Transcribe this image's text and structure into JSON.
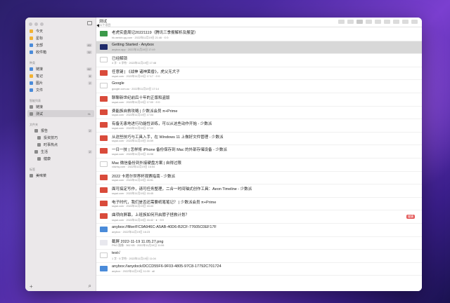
{
  "colors": {
    "window_bg": "#ffffff",
    "sidebar_bg": "#ebe8ea",
    "selected_row": "#d8d8d8",
    "tag_red": "#e45b5b",
    "accent_blue": "#4a8bd9"
  },
  "sidebar": {
    "top_items": [
      {
        "label": "今天",
        "icon": "sun-icon",
        "color": "#f2b233",
        "count": ""
      },
      {
        "label": "星标",
        "icon": "star-icon",
        "color": "#f2b233",
        "count": ""
      },
      {
        "label": "全部",
        "icon": "tray-icon",
        "color": "#4a8bd9",
        "count": "83"
      },
      {
        "label": "收件箱",
        "icon": "inbox-icon",
        "color": "#4a8bd9",
        "count": "32"
      }
    ],
    "type_section": "种类",
    "type_items": [
      {
        "label": "链接",
        "icon": "link-icon",
        "color": "#4a8bd9",
        "count": "62"
      },
      {
        "label": "笔记",
        "icon": "note-icon",
        "color": "#f2b233",
        "count": "8"
      },
      {
        "label": "图片",
        "icon": "image-icon",
        "color": "#4a8bd9",
        "count": "2"
      },
      {
        "label": "文件",
        "icon": "file-icon",
        "color": "#4a8bd9",
        "count": ""
      }
    ],
    "smart_section": "智能列表",
    "smart_items": [
      {
        "label": "链接",
        "icon": "smart-list-icon",
        "color": "#8a8a8a",
        "count": ""
      },
      {
        "label": "测试",
        "icon": "smart-list-icon",
        "color": "#8a8a8a",
        "count": "31"
      }
    ],
    "folder_section": "文件夹",
    "folder_items": [
      {
        "label": "报告",
        "level": 1,
        "count": "2"
      },
      {
        "label": "投资技巧",
        "level": 2,
        "count": ""
      },
      {
        "label": "时事热点",
        "level": 2,
        "count": ""
      },
      {
        "label": "生活",
        "level": 1,
        "count": "2"
      },
      {
        "label": "健康",
        "level": 2,
        "count": ""
      }
    ],
    "tag_section": "标签",
    "tag_items": [
      {
        "label": "美味菜",
        "icon": "tag-icon",
        "color": "#8a8a8a",
        "count": ""
      }
    ],
    "add_label": "+",
    "search_label": "⌕"
  },
  "toolbar": {
    "title": "测试",
    "subtitle": "31个项目"
  },
  "items": [
    {
      "title": "老虎实盘周记20221119（腾讯三季报解析及展望）",
      "meta": "hk.weixin.qq.com · 2022年11月19日 21:46 · ⊙⊙",
      "fav_color": "#3c9a4a",
      "tag": ""
    },
    {
      "title": "Getting Started - Anybox",
      "meta": "anybox.app · 2022年11月19日 17:49",
      "fav_color": "#1f2b6b",
      "tag": ""
    },
    {
      "title": "已经解锁",
      "meta": "4 字 · 4 字符 · 2022年11月19日 17:48",
      "fav_color": "#ffffff",
      "tag": ""
    },
    {
      "title": "任意键 | 《战神 诸神黄昏》，虎父无犬子",
      "meta": "sspai.com · 2022年11月19日 17:17 · ⊙⊙",
      "fav_color": "#d94b3b",
      "tag": ""
    },
    {
      "title": "Google",
      "meta": "google.com.au · 2022年11月19日 17:14",
      "fav_color": "#ffffff",
      "tag": ""
    },
    {
      "title": "聊聊新世纪前后十年的正版和盗版",
      "meta": "sspai.com · 2022年11月19日 17:00 · ⊙⊙",
      "fav_color": "#d94b3b",
      "tag": ""
    },
    {
      "title": "费能族自救攻略 | 少数派会员 π+Prime",
      "meta": "sspai.com · 2022年11月19日 17:04",
      "fav_color": "#d94b3b",
      "tag": ""
    },
    {
      "title": "有备无患地进行功能性训练，可以从这些动作开始 - 少数派",
      "meta": "sspai.com · 2022年11月19日 17:00",
      "fav_color": "#d94b3b",
      "tag": ""
    },
    {
      "title": "从这些技巧与工具入手，在 Windows 11 上做好文件管理 - 少数派",
      "meta": "sspai.com · 2022年11月19日 16:59",
      "fav_color": "#d94b3b",
      "tag": ""
    },
    {
      "title": "一日一技 | 怎样将 iPhone 备份保存到 Mac 的外部存储设备 - 少数派",
      "meta": "sspai.com · 2022年11月19日 16:58",
      "fav_color": "#d94b3b",
      "tag": ""
    },
    {
      "title": "Mac 微信备份到外接硬盘方案 | 自得过限",
      "meta": "xldzhq.com · 2022年11月19日 16:54",
      "fav_color": "#ffffff",
      "tag": ""
    },
    {
      "title": "2022 卡塔尔世界杯观赛指南 - 少数派",
      "meta": "sspai.com · 2022年11月19日 16:51",
      "fav_color": "#d94b3b",
      "tag": ""
    },
    {
      "title": "面可搞定写作，请可任务整理，二合一时间轴式创作工具：Aeon Timeline - 少数派",
      "meta": "sspai.com · 2022年11月19日 16:45",
      "fav_color": "#d94b3b",
      "tag": ""
    },
    {
      "title": "电子时代，我们是否还需要纸笔笔记？ | 少数派会员 π+Prime",
      "meta": "sspai.com · 2022年11月19日 16:43",
      "fav_color": "#d94b3b",
      "tag": ""
    },
    {
      "title": "曲项向屏幕，上班族如何开启脖子拯救计划？",
      "meta": "sspai.com · 2022年11月19日 16:42 · ● · ⊙⊙",
      "fav_color": "#d94b3b",
      "tag": "健康"
    },
    {
      "title": "anybox://filter/FC9A946C-A5AB-40D6-B2CF-77605C0EF17F",
      "meta": "anybox · 2022年11月19日 16:23",
      "fav_color": "#4a8bd9",
      "tag": ""
    },
    {
      "title": "截屏 2022-11-19 11.05.27.png",
      "meta": "PNG 图像 · 362 KB · 2022年11月19日 11:06",
      "fav_color": "#e8e8ee",
      "tag": ""
    },
    {
      "title": "test√",
      "meta": "1 字 · 5 字符 · 2022年11月19日 11:04",
      "fav_color": "#ffffff",
      "tag": ""
    },
    {
      "title": "anybox://anydock/DCCD55F6-9F03-4805-97C8-17792C701724",
      "meta": "anybox · 2022年11月19日 11:00 · all",
      "fav_color": "#4a8bd9",
      "tag": ""
    }
  ]
}
